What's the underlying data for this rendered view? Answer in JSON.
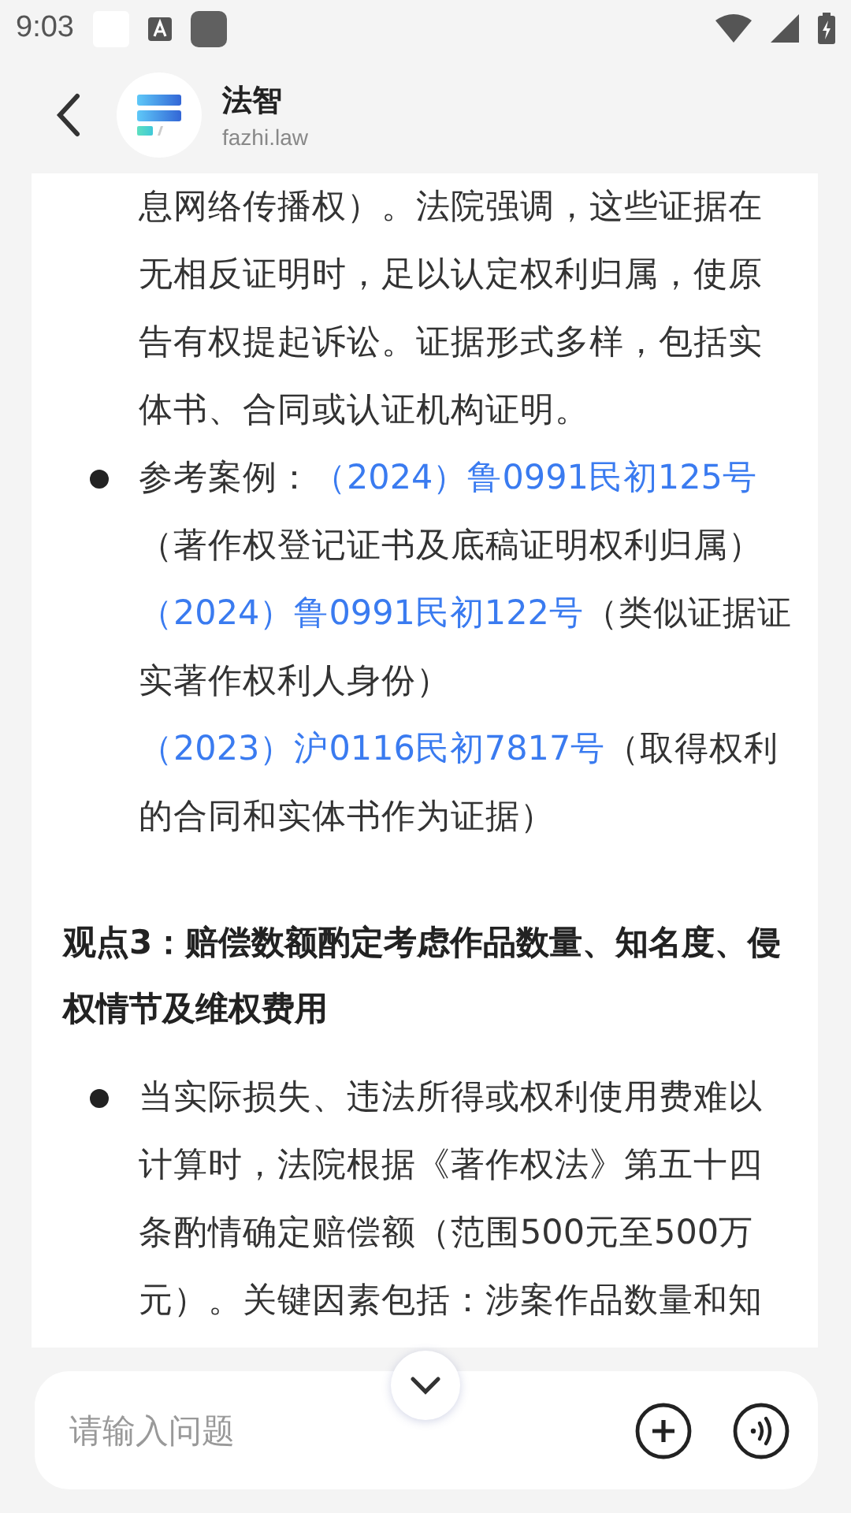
{
  "status_bar": {
    "time": "9:03"
  },
  "header": {
    "title": "法智",
    "subtitle": "fazhi.law"
  },
  "content": [
    {
      "kind": "continuation",
      "text": "息网络传播权）。法院强调，这些证据在无相反证明时，足以认定权利归属，使原告有权提起诉讼。证据形式多样，包括实体书、合同或认证机构证明。"
    },
    {
      "kind": "references",
      "label": "参考案例：",
      "cases": [
        {
          "case_no": "（2024）鲁0991民初125号",
          "note": "（著作权登记证书及底稿证明权利归属）"
        },
        {
          "case_no": "（2024）鲁0991民初122号",
          "note": "（类似证据证实著作权利人身份）"
        },
        {
          "case_no": "（2023）沪0116民初7817号",
          "note": "（取得权利的合同和实体书作为证据）"
        }
      ]
    },
    {
      "kind": "heading",
      "text": "观点3：赔偿数额酌定考虑作品数量、知名度、侵权情节及维权费用"
    },
    {
      "kind": "bullet",
      "text": "当实际损失、违法所得或权利使用费难以计算时，法院根据《著作权法》第五十四条酌情确定赔偿额（范围500元至500万元）。关键因素包括：涉案作品数量和知"
    }
  ],
  "input": {
    "placeholder": "请输入问题"
  }
}
